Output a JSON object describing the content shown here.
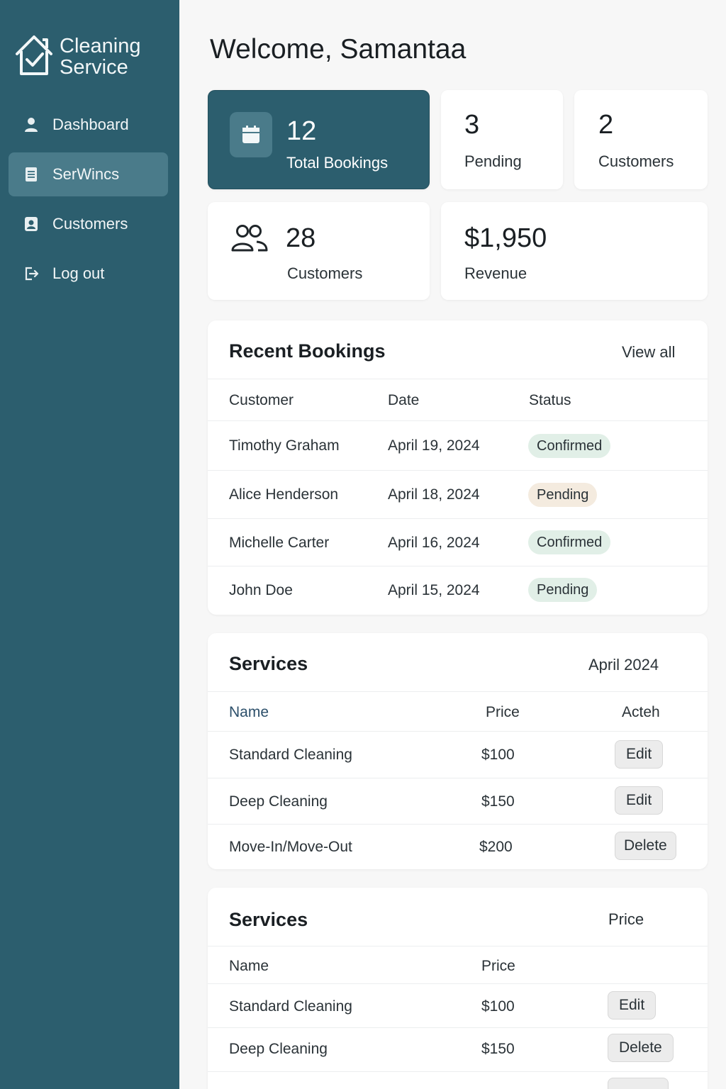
{
  "brand": {
    "line1": "Cleaning",
    "line2": "Service"
  },
  "sidebar": {
    "items": [
      {
        "label": "Dashboard",
        "icon": "user-icon"
      },
      {
        "label": "SerWincs",
        "icon": "document-icon",
        "active": true
      },
      {
        "label": "Customers",
        "icon": "contact-card-icon"
      },
      {
        "label": "Log out",
        "icon": "logout-icon"
      }
    ]
  },
  "header": {
    "welcome": "Welcome, Samantaa"
  },
  "stats": {
    "total_bookings": {
      "value": "12",
      "label": "Total Bookings",
      "icon": "calendar-icon"
    },
    "pending": {
      "value": "3",
      "label": "Pending"
    },
    "customers_small": {
      "value": "2",
      "label": "Customers"
    },
    "customers": {
      "value": "28",
      "label": "Customers",
      "icon": "users-icon"
    },
    "revenue": {
      "value": "$1,950",
      "label": "Revenue"
    }
  },
  "recent_bookings": {
    "title": "Recent Bookings",
    "view_all": "View all",
    "columns": [
      "Customer",
      "Date",
      "Status"
    ],
    "rows": [
      {
        "customer": "Timothy Graham",
        "date": "April 19, 2024",
        "status": "Confirmed"
      },
      {
        "customer": "Alice Henderson",
        "date": "April 18, 2024",
        "status": "Pending"
      },
      {
        "customer": "Michelle Carter",
        "date": "April 16, 2024",
        "status": "Confirmed"
      },
      {
        "customer": "John Doe",
        "date": "April 15, 2024",
        "status": "Pending"
      }
    ]
  },
  "services1": {
    "title": "Services",
    "period": "April 2024",
    "columns": [
      "Name",
      "Price",
      "Acteh"
    ],
    "rows": [
      {
        "name": "Standard Cleaning",
        "price": "$100",
        "action": "Edit"
      },
      {
        "name": "Deep Cleaning",
        "price": "$150",
        "action": "Edit"
      },
      {
        "name": "Move-In/Move-Out",
        "price": "$200",
        "action": "Delete"
      }
    ]
  },
  "services2": {
    "title": "Services",
    "header_right": "Price",
    "columns": [
      "Name",
      "Price"
    ],
    "rows": [
      {
        "name": "Standard Cleaning",
        "price": "$100",
        "action": "Edit"
      },
      {
        "name": "Deep Cleaning",
        "price": "$150",
        "action": "Delete"
      }
    ]
  },
  "colors": {
    "sidebar": "#2c5e6e",
    "sidebar_active": "#4a7b8a",
    "confirmed_badge": "#e1efe7",
    "pending_badge": "#f4ebdf"
  }
}
